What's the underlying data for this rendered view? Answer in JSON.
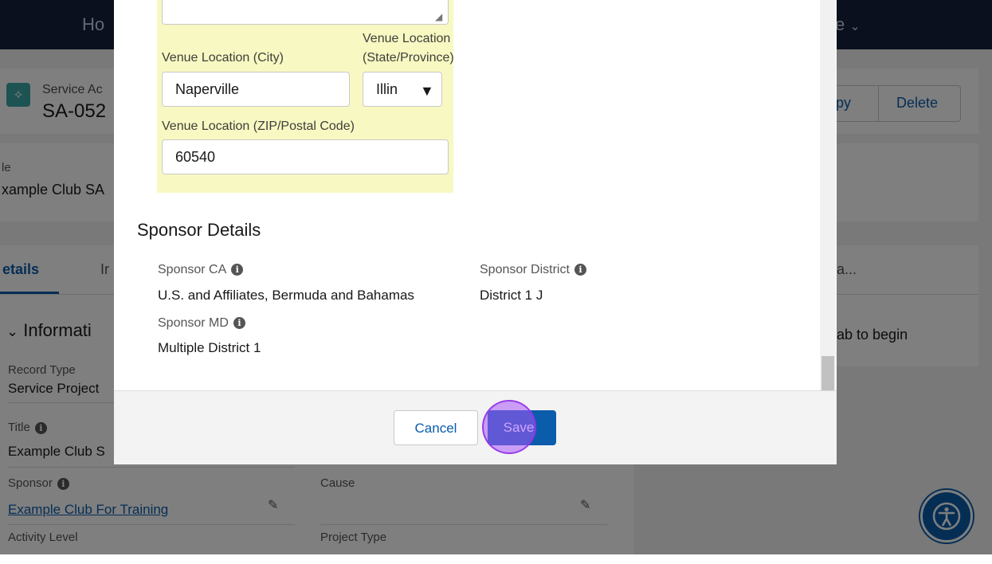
{
  "page": {
    "nav_left": "Ho",
    "nav_right": "e",
    "header_subtitle": "Service Ac",
    "header_title": "SA-052",
    "copy_label": "opy",
    "delete_label": "Delete",
    "highlight_label": "le",
    "highlight_value": "xample Club SA",
    "tab_details": "etails",
    "tab_i": "Ir",
    "side_tab": "a...",
    "side_msg": "ab to begin",
    "info_section": "Informati",
    "record_type_label": "Record Type",
    "record_type_value": "Service Project",
    "title_label": "Title",
    "title_value": "Example Club S",
    "sponsor_label": "Sponsor",
    "sponsor_value": "Example Club For Training",
    "cause_label": "Cause",
    "activity_level_label": "Activity Level",
    "project_type_label": "Project Type"
  },
  "modal": {
    "venue_city_label": "Venue Location (City)",
    "venue_city_value": "Naperville",
    "venue_state_label_1": "Venue Location",
    "venue_state_label_2": "(State/Province)",
    "venue_state_value": "Illin",
    "venue_zip_label": "Venue Location (ZIP/Postal Code)",
    "venue_zip_value": "60540",
    "sponsor_section_title": "Sponsor Details",
    "sponsor_ca_label": "Sponsor CA",
    "sponsor_ca_value": "U.S. and Affiliates, Bermuda and Bahamas",
    "sponsor_district_label": "Sponsor District",
    "sponsor_district_value": "District 1 J",
    "sponsor_md_label": "Sponsor MD",
    "sponsor_md_value": "Multiple District 1",
    "cancel_label": "Cancel",
    "save_label": "Save"
  },
  "icons": {
    "info": "i",
    "chevron": "chevron-down-icon",
    "pencil": "pencil-icon",
    "accessibility": "accessibility-icon"
  },
  "colors": {
    "brand_blue": "#0b5cab",
    "highlight_yellow": "#f8f9c2",
    "click_indicator": "#a855f7"
  }
}
